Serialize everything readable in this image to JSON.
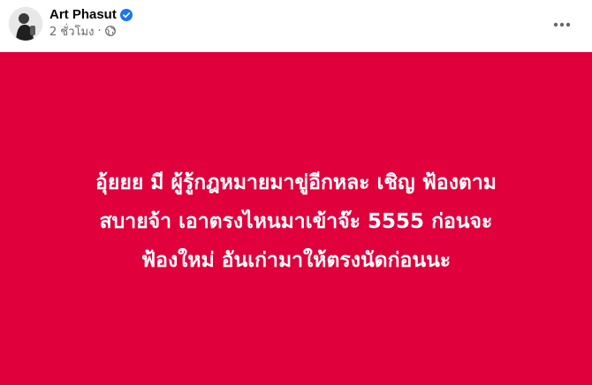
{
  "post": {
    "author": {
      "name": "Art Phasut",
      "verified_icon": "verified-badge-icon",
      "verified_color": "#1877f2"
    },
    "meta": {
      "timestamp": "2 ชั่วโมง",
      "separator": "·",
      "audience_icon": "globe-icon"
    },
    "more_icon": "more-horizontal-icon",
    "card": {
      "background_color": "#e0003c",
      "text_color": "#ffffff",
      "lines": [
        "อุ้ยยย มี ผู้รู้กฎหมายมาขู่อีกหละ เชิญ ฟ้องตาม",
        "สบายจ้า เอาตรงไหนมาเข้าจ๊ะ 5555 ก่อนจะ",
        "ฟ้องใหม่ อันเก่ามาให้ตรงนัดก่อนนะ"
      ]
    }
  }
}
